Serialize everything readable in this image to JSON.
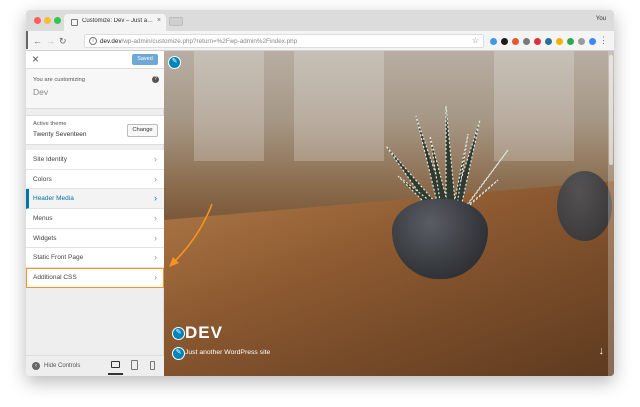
{
  "browser": {
    "tab_title": "Customize: Dev – Just another",
    "tab_close": "×",
    "profile": "You",
    "url_host": "dev.dev",
    "url_path": "/wp-admin/customize.php?return=%2Fwp-admin%2Findex.php",
    "extensions_colors": [
      "#3c9be8",
      "#1b1b1b",
      "#e45b2f",
      "#7a7a7a",
      "#d9343c",
      "#2a6f97",
      "#f0b400",
      "#2eaa4a",
      "#9b9b9b",
      "#4285f4"
    ]
  },
  "customizer": {
    "saved_label": "Saved",
    "customizing_label": "You are customizing",
    "site_name": "Dev",
    "active_theme_label": "Active theme",
    "theme_name": "Twenty Seventeen",
    "change_label": "Change",
    "menu": [
      {
        "label": "Site Identity"
      },
      {
        "label": "Colors"
      },
      {
        "label": "Header Media"
      },
      {
        "label": "Menus"
      },
      {
        "label": "Widgets"
      },
      {
        "label": "Static Front Page"
      },
      {
        "label": "Additional CSS"
      }
    ],
    "hide_controls_label": "Hide Controls",
    "accent_color": "#0073aa",
    "highlight_color": "#f7941d"
  },
  "preview": {
    "site_title": "DEV",
    "site_description": "Just another WordPress site"
  }
}
